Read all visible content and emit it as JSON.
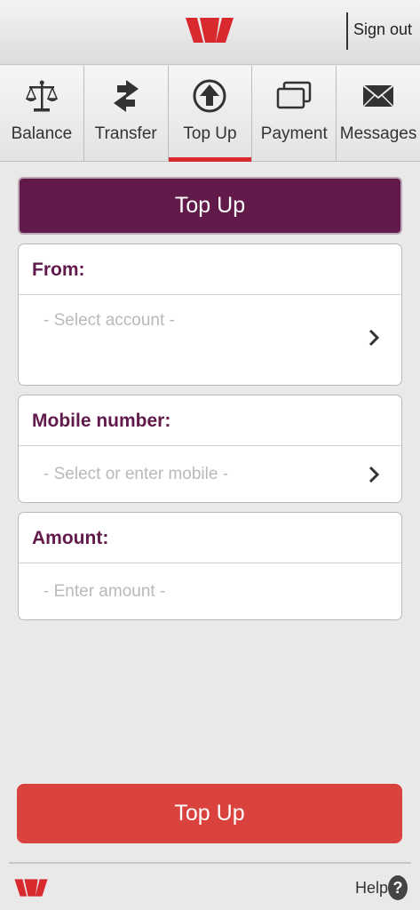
{
  "header": {
    "signout_label": "Sign out"
  },
  "tabs": [
    {
      "label": "Balance",
      "icon": "scales-icon"
    },
    {
      "label": "Transfer",
      "icon": "transfer-arrows-icon"
    },
    {
      "label": "Top Up",
      "icon": "upload-arrow-icon",
      "active": true
    },
    {
      "label": "Payment",
      "icon": "cards-icon"
    },
    {
      "label": "Messages",
      "icon": "envelope-icon"
    }
  ],
  "page_title": "Top Up",
  "form": {
    "from": {
      "label": "From:",
      "placeholder": "- Select account -"
    },
    "mobile": {
      "label": "Mobile number:",
      "placeholder": "- Select or enter mobile -"
    },
    "amount": {
      "label": "Amount:",
      "placeholder": "- Enter amount -"
    }
  },
  "action_button": "Top Up",
  "footer": {
    "help_label": "Help",
    "help_icon": "?"
  },
  "colors": {
    "brand": "#621a4b",
    "accent": "#d9423d",
    "logo": "#d8292f"
  }
}
